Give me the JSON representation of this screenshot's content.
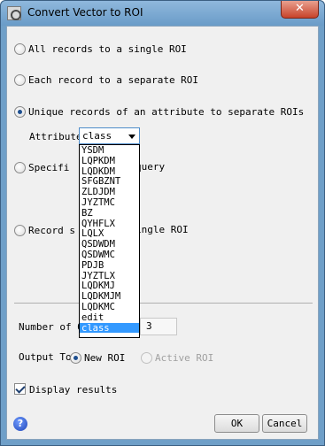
{
  "window": {
    "title": "Convert Vector to ROI",
    "close_glyph": "✕"
  },
  "options": {
    "all_records": "All records to a single ROI",
    "each_record": "Each record to a separate ROI",
    "unique_records": "Unique records of an attribute to separate ROIs",
    "specific_visible": "Specifi",
    "specific_tail": "query",
    "record_visible": "Record s",
    "record_tail": "ingle ROI",
    "selected_option": "unique_records"
  },
  "attribute": {
    "label": "Attribute",
    "selected": "class",
    "items": [
      "YSDM",
      "LQPKDM",
      "LQDKDM",
      "SFGBZNT",
      "ZLDJDM",
      "JYZTMC",
      "BZ",
      "QYHFLX",
      "LQLX",
      "QSDWDM",
      "QSDWMC",
      "PDJB",
      "JYZTLX",
      "LQDKMJ",
      "LQDKMJM",
      "LQDKMC",
      "edit",
      "class"
    ]
  },
  "number_of": {
    "label": "Number of O",
    "value": "3"
  },
  "output_to": {
    "label": "Output To",
    "new_roi": "New ROI",
    "active_roi": "Active ROI",
    "selected": "new_roi"
  },
  "display_results": {
    "label": "Display results",
    "checked": true
  },
  "buttons": {
    "help": "?",
    "ok": "OK",
    "cancel": "Cancel"
  }
}
